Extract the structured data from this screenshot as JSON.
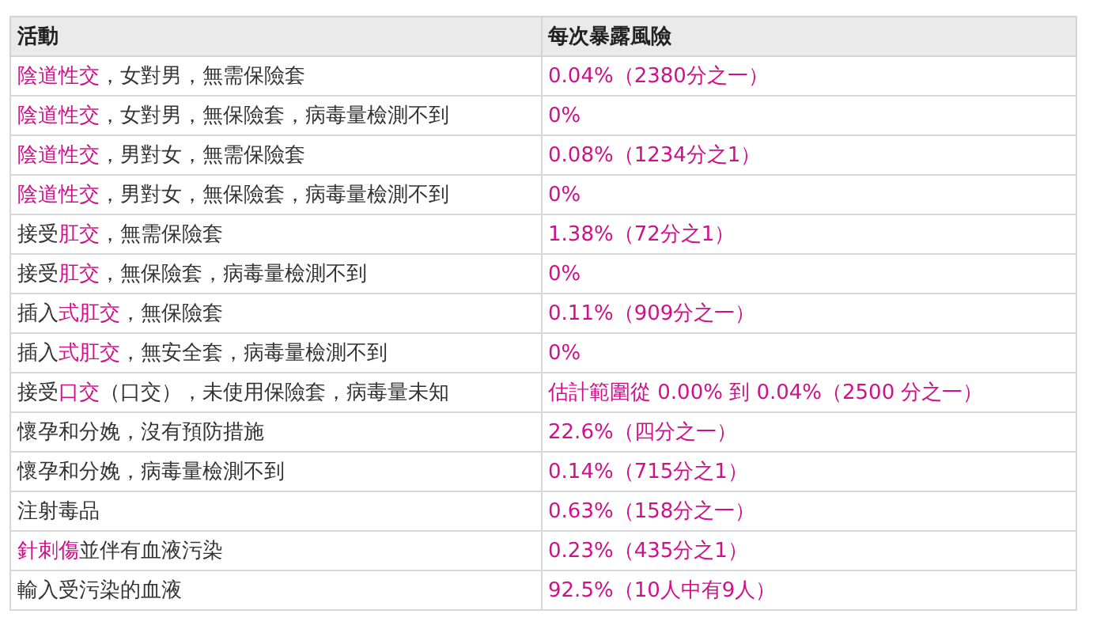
{
  "table": {
    "columns": [
      "活動",
      "每次暴露風險"
    ],
    "rows": [
      {
        "activity": [
          {
            "text": "陰道性交",
            "link": true
          },
          {
            "text": "，女對男，無需保險套",
            "link": false
          }
        ],
        "risk": "0.04%（2380分之一）"
      },
      {
        "activity": [
          {
            "text": "陰道性交",
            "link": true
          },
          {
            "text": "，女對男，無保險套，病毒量檢測不到",
            "link": false
          }
        ],
        "risk": "0%"
      },
      {
        "activity": [
          {
            "text": "陰道性交",
            "link": true
          },
          {
            "text": "，男對女，無需保險套",
            "link": false
          }
        ],
        "risk": "0.08%（1234分之1）"
      },
      {
        "activity": [
          {
            "text": "陰道性交",
            "link": true
          },
          {
            "text": "，男對女，無保險套，病毒量檢測不到",
            "link": false
          }
        ],
        "risk": "0%"
      },
      {
        "activity": [
          {
            "text": "接受",
            "link": false
          },
          {
            "text": "肛交",
            "link": true
          },
          {
            "text": "，無需保險套",
            "link": false
          }
        ],
        "risk": "1.38%（72分之1）"
      },
      {
        "activity": [
          {
            "text": "接受",
            "link": false
          },
          {
            "text": "肛交",
            "link": true
          },
          {
            "text": "，無保險套，病毒量檢測不到",
            "link": false
          }
        ],
        "risk": "0%"
      },
      {
        "activity": [
          {
            "text": "插入",
            "link": false
          },
          {
            "text": "式肛交",
            "link": true
          },
          {
            "text": "，無保險套",
            "link": false
          }
        ],
        "risk": "0.11%（909分之一）"
      },
      {
        "activity": [
          {
            "text": "插入",
            "link": false
          },
          {
            "text": "式肛交",
            "link": true
          },
          {
            "text": "，無安全套，病毒量檢測不到",
            "link": false
          }
        ],
        "risk": "0%"
      },
      {
        "activity": [
          {
            "text": "接受",
            "link": false
          },
          {
            "text": "口交",
            "link": true
          },
          {
            "text": "（口交），未使用保險套，病毒量未知",
            "link": false
          }
        ],
        "risk": "估計範圍從 0.00% 到 0.04%（2500 分之一）"
      },
      {
        "activity": [
          {
            "text": "懷孕和分娩，沒有預防措施",
            "link": false
          }
        ],
        "risk": "22.6%（四分之一）"
      },
      {
        "activity": [
          {
            "text": "懷孕和分娩，病毒量檢測不到",
            "link": false
          }
        ],
        "risk": "0.14%（715分之1）"
      },
      {
        "activity": [
          {
            "text": "注射毒品",
            "link": false
          }
        ],
        "risk": "0.63%（158分之一）"
      },
      {
        "activity": [
          {
            "text": "針刺傷",
            "link": true
          },
          {
            "text": "並伴有血液污染",
            "link": false
          }
        ],
        "risk": "0.23%（435分之1）"
      },
      {
        "activity": [
          {
            "text": "輸入受污染的血液",
            "link": false
          }
        ],
        "risk": "92.5%（10人中有9人）"
      }
    ]
  }
}
